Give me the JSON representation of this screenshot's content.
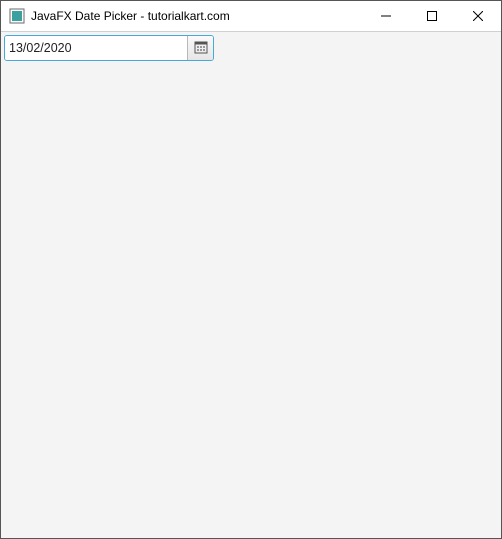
{
  "window": {
    "title": "JavaFX Date Picker - tutorialkart.com"
  },
  "datepicker": {
    "value": "13/02/2020"
  }
}
